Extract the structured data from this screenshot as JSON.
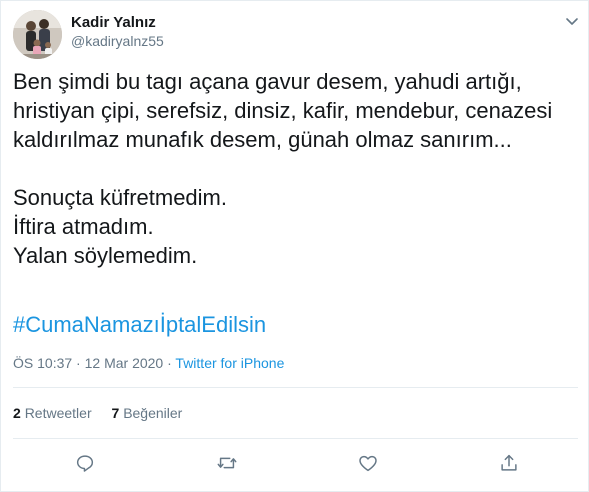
{
  "author": {
    "name": "Kadir Yalnız",
    "handle": "@kadiryalnz55"
  },
  "tweet": {
    "lines": [
      "Ben şimdi bu tagı açana gavur desem, yahudi artığı,",
      "hristiyan çipi, serefsiz, dinsiz, kafir, mendebur, cenazesi",
      "kaldırılmaz munafık desem, günah olmaz sanırım...",
      "",
      "Sonuçta küfretmedim.",
      "İftira atmadım.",
      "Yalan söylemedim."
    ],
    "hashtag": "#CumaNamazıİptalEdilsin",
    "time": "ÖS 10:37",
    "dot": "·",
    "date": "12 Mar 2020",
    "source": "Twitter for iPhone"
  },
  "stats": {
    "retweets_count": "2",
    "retweets_label": "Retweetler",
    "likes_count": "7",
    "likes_label": "Beğeniler"
  },
  "icons": {
    "caret": "chevron-down-icon",
    "reply": "reply-icon",
    "retweet": "retweet-icon",
    "like": "heart-icon",
    "share": "share-icon"
  },
  "colors": {
    "text": "#14171a",
    "secondary": "#657786",
    "link": "#1b95e0",
    "border": "#e6ecf0"
  }
}
